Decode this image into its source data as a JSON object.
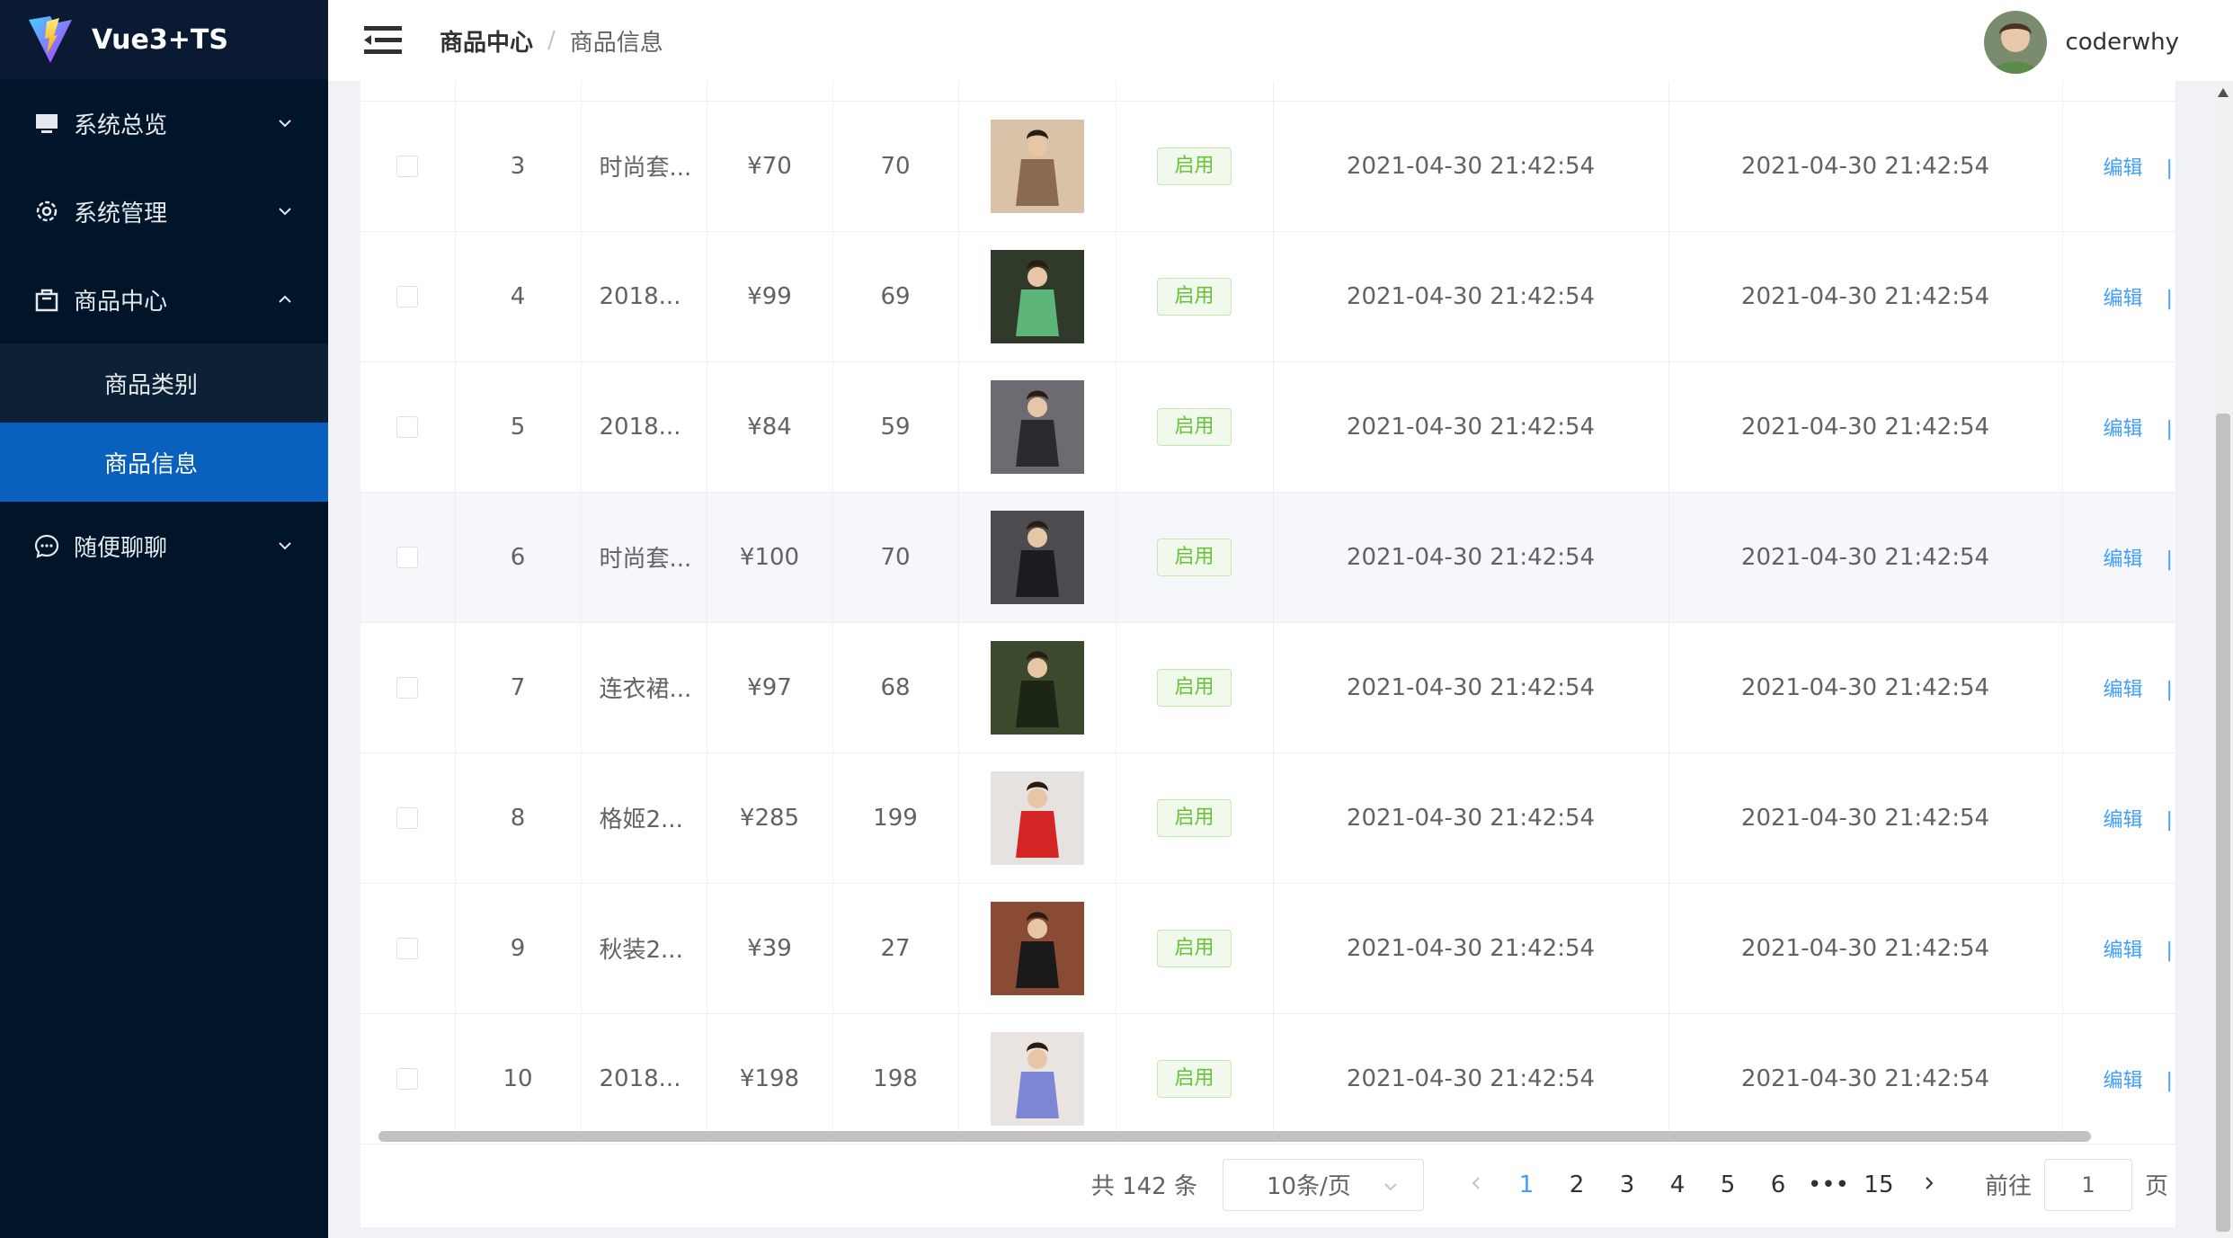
{
  "app": {
    "title": "Vue3+TS"
  },
  "sidebar": {
    "menu": [
      {
        "label": "系统总览",
        "icon": "monitor-icon"
      },
      {
        "label": "系统管理",
        "icon": "gear-icon"
      },
      {
        "label": "商品中心",
        "icon": "shopping-bag-icon",
        "expanded": true,
        "children": [
          {
            "label": "商品类别"
          },
          {
            "label": "商品信息",
            "active": true
          }
        ]
      },
      {
        "label": "随便聊聊",
        "icon": "chat-icon"
      }
    ]
  },
  "header": {
    "breadcrumb": [
      "商品中心",
      "商品信息"
    ],
    "breadcrumb_separator": "/",
    "username": "coderwhy"
  },
  "table": {
    "rows": [
      {
        "index": "3",
        "name": "时尚套...",
        "price": "¥70",
        "stock": "70",
        "status": "启用",
        "created": "2021-04-30 21:42:54",
        "updated": "2021-04-30 21:42:54",
        "edit": "编辑",
        "thumb": "photo-woman-beige-dress"
      },
      {
        "index": "4",
        "name": "2018...",
        "price": "¥99",
        "stock": "69",
        "status": "启用",
        "created": "2021-04-30 21:42:54",
        "updated": "2021-04-30 21:42:54",
        "edit": "编辑",
        "thumb": "photo-woman-green-sweater"
      },
      {
        "index": "5",
        "name": "2018...",
        "price": "¥84",
        "stock": "59",
        "status": "启用",
        "created": "2021-04-30 21:42:54",
        "updated": "2021-04-30 21:42:54",
        "edit": "编辑",
        "thumb": "photo-woman-street"
      },
      {
        "index": "6",
        "name": "时尚套...",
        "price": "¥100",
        "stock": "70",
        "status": "启用",
        "created": "2021-04-30 21:42:54",
        "updated": "2021-04-30 21:42:54",
        "edit": "编辑",
        "thumb": "photo-woman-stairs"
      },
      {
        "index": "7",
        "name": "连衣裙...",
        "price": "¥97",
        "stock": "68",
        "status": "启用",
        "created": "2021-04-30 21:42:54",
        "updated": "2021-04-30 21:42:54",
        "edit": "编辑",
        "thumb": "photo-woman-floral-dress"
      },
      {
        "index": "8",
        "name": "格姬2...",
        "price": "¥285",
        "stock": "199",
        "status": "启用",
        "created": "2021-04-30 21:42:54",
        "updated": "2021-04-30 21:42:54",
        "edit": "编辑",
        "thumb": "photo-woman-red-coat"
      },
      {
        "index": "9",
        "name": "秋装2...",
        "price": "¥39",
        "stock": "27",
        "status": "启用",
        "created": "2021-04-30 21:42:54",
        "updated": "2021-04-30 21:42:54",
        "edit": "编辑",
        "thumb": "photo-woman-brick-wall"
      },
      {
        "index": "10",
        "name": "2018...",
        "price": "¥198",
        "stock": "198",
        "status": "启用",
        "created": "2021-04-30 21:42:54",
        "updated": "2021-04-30 21:42:54",
        "edit": "编辑",
        "thumb": "photo-woman-blue-pants"
      }
    ]
  },
  "pagination": {
    "total": "共 142 条",
    "page_size": "10条/页",
    "pages": [
      "1",
      "2",
      "3",
      "4",
      "5",
      "6"
    ],
    "ellipsis": "•••",
    "last": "15",
    "goto_prefix": "前往",
    "goto_value": "1",
    "goto_suffix": "页"
  },
  "colors": {
    "sidebar_bg": "#001529",
    "active_menu": "#0a60bd",
    "link": "#409eff",
    "tag_green": "#67c23a"
  }
}
